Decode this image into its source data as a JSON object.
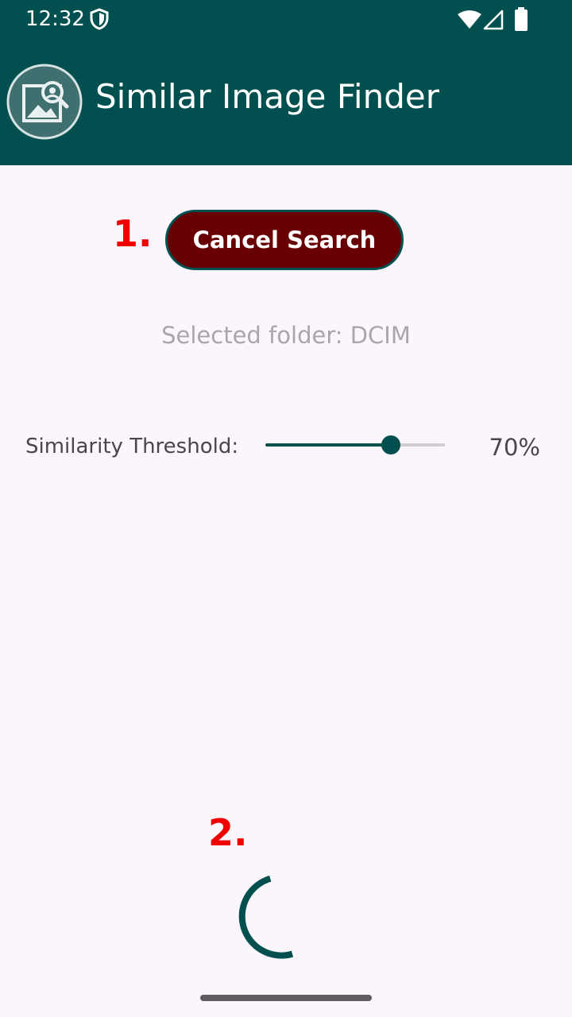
{
  "status_bar": {
    "time": "12:32",
    "icons": [
      "shield-icon",
      "wifi-icon",
      "signal-icon",
      "battery-icon"
    ]
  },
  "app_bar": {
    "title": "Similar Image Finder",
    "logo_icon": "image-search-icon",
    "background_color": "#01504F"
  },
  "annotations": {
    "marker_1": "1.",
    "marker_2": "2.",
    "color": "#F00000"
  },
  "main": {
    "cancel_button_label": "Cancel Search",
    "cancel_button_color": "#680003",
    "selected_folder_text": "Selected folder: DCIM",
    "threshold": {
      "label": "Similarity Threshold:",
      "value_text": "70%",
      "slider_fraction": 0.7
    }
  },
  "progress": {
    "indeterminate": true,
    "color": "#01504F"
  }
}
